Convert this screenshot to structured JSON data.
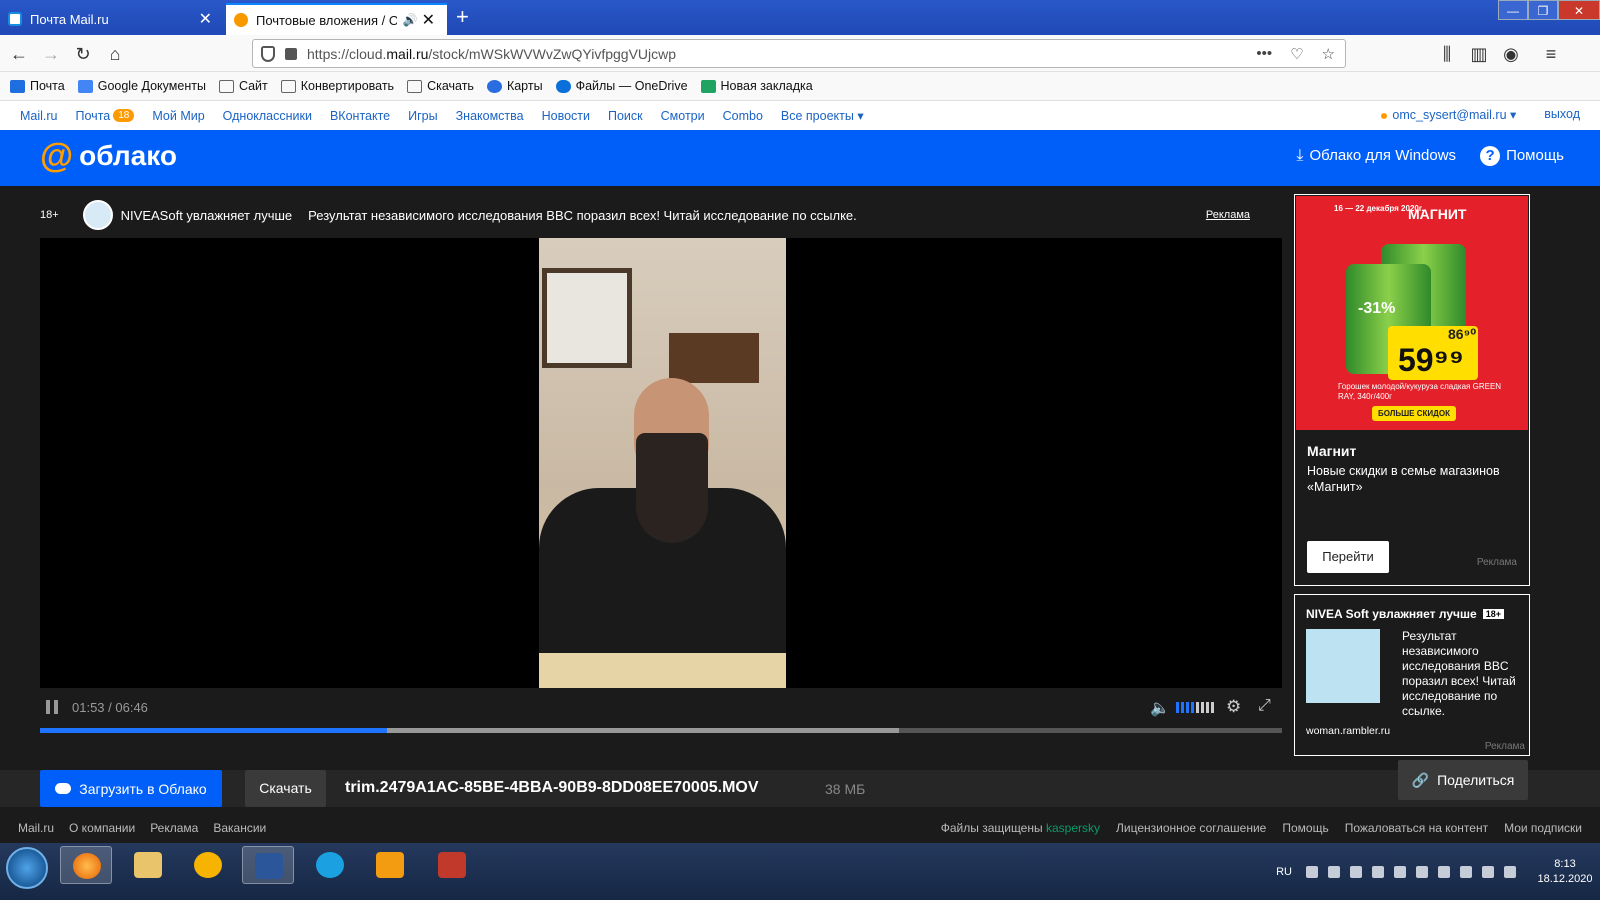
{
  "browser": {
    "tabs": [
      {
        "label": "Почта Mail.ru"
      },
      {
        "label": "Почтовые вложения / Обл"
      }
    ],
    "url_prefix": "https://cloud.",
    "url_domain": "mail.ru",
    "url_path": "/stock/mWSkWVWvZwQYivfpggVUjcwp"
  },
  "bookmarks": [
    "Почта",
    "Google Документы",
    "Сайт",
    "Конвертировать",
    "Скачать",
    "Карты",
    "Файлы — OneDrive",
    "Новая закладка"
  ],
  "portal": {
    "links": [
      "Mail.ru",
      "Почта",
      "Мой Мир",
      "Одноклассники",
      "ВКонтакте",
      "Игры",
      "Знакомства",
      "Новости",
      "Поиск",
      "Смотри",
      "Combo",
      "Все проекты"
    ],
    "mail_badge": "18",
    "user": "omc_sysert@mail.ru",
    "logout": "выход"
  },
  "cloud": {
    "logo": "облако",
    "windows_link": "Облако для Windows",
    "help": "Помощь"
  },
  "adline": {
    "age": "18+",
    "brand": "NIVEASoft увлажняет лучше",
    "text": "Результат независимого исследования BBC поразил всех! Читай исследование по ссылке.",
    "label": "Реклама"
  },
  "player": {
    "time": "01:53 / 06:46",
    "played_fraction": 0.279,
    "buffered_fraction": 0.692,
    "volume_bars_total": 8,
    "volume_bars_on": 4
  },
  "ad_magnit": {
    "dates": "16 — 22 декабря 2020г.",
    "brand": "МАГНИТ",
    "discount": "-31%",
    "old_price": "86⁹⁰",
    "new_price": "59⁹⁹",
    "fine": "Горошек молодой/кукуруза сладкая GREEN RAY, 340г/400г",
    "cta": "БОЛЬШЕ СКИДОК",
    "title": "Магнит",
    "desc": "Новые скидки в семье магазинов «Магнит»",
    "button": "Перейти",
    "label": "Реклама"
  },
  "ad_nivea": {
    "title": "NIVEA Soft увлажняет лучше",
    "age": "18+",
    "desc": "Результат независимого исследования BBC поразил всех! Читай исследование по ссылке.",
    "domain": "woman.rambler.ru",
    "label": "Реклама"
  },
  "filebar": {
    "upload": "Загрузить в Облако",
    "download": "Скачать",
    "filename": "trim.2479A1AC-85BE-4BBA-90B9-8DD08EE70005.MOV",
    "size": "38 МБ",
    "share": "Поделиться"
  },
  "footer": {
    "left": [
      "Mail.ru",
      "О компании",
      "Реклама",
      "Вакансии"
    ],
    "protected": "Файлы защищены",
    "kaspersky": "kaspersky",
    "right": [
      "Лицензионное соглашение",
      "Помощь",
      "Пожаловаться на контент",
      "Мои подписки"
    ]
  },
  "taskbar": {
    "lang": "RU",
    "time": "8:13",
    "date": "18.12.2020"
  },
  "colors": {
    "accent": "#005ff9",
    "orange": "#ff9e00",
    "player_progress": "#1e74ff"
  }
}
